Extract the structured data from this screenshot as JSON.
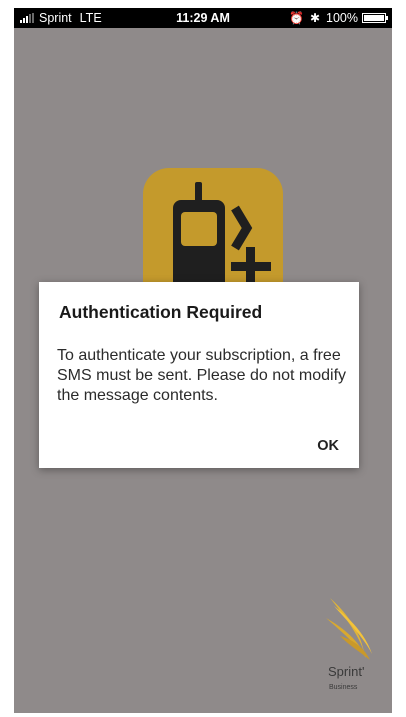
{
  "status_bar": {
    "carrier": "Sprint",
    "network": "LTE",
    "time": "11:29 AM",
    "battery": "100%",
    "icons": [
      "signal-bars-icon",
      "alarm-clock-icon",
      "bluetooth-icon",
      "battery-icon"
    ]
  },
  "app_icon": {
    "icon": "walkie-talkie-plus-icon",
    "color": "#c49a2c"
  },
  "dialog": {
    "title": "Authentication Required",
    "message": "To authenticate your subscription, a free SMS must be sent. Please do not modify the message contents.",
    "ok_label": "OK"
  },
  "brand": {
    "name": "Sprint",
    "registered_mark": "'",
    "sub": "Business",
    "accent": "#f3c33a"
  },
  "colors": {
    "overlay": "#8f8a8a",
    "statusbar": "#000000"
  }
}
